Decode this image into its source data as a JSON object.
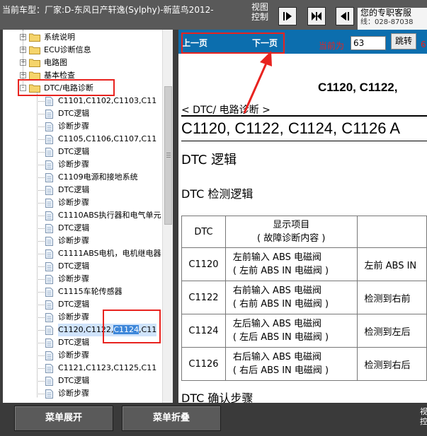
{
  "header": {
    "vehicle_label": "当前车型：厂家:D-东风日产轩逸(Sylphy)-新蓝鸟2012-",
    "view_control": "视图控制",
    "support_line1": "您的专职客服",
    "support_line2": "线：028-87038",
    "nav_buttons": [
      "go-next",
      "split-view",
      "go-previous"
    ]
  },
  "tree": {
    "items": [
      {
        "type": "folder",
        "label": "系统说明",
        "expander": "+"
      },
      {
        "type": "folder",
        "label": "ECU诊断信息",
        "expander": "+"
      },
      {
        "type": "folder",
        "label": "电路图",
        "expander": "+"
      },
      {
        "type": "folder",
        "label": "基本检查",
        "expander": "+"
      },
      {
        "type": "folder",
        "label": "DTC/电路诊断",
        "expander": "-",
        "open": true
      },
      {
        "type": "doc",
        "label": "C1101,C1102,C1103,C11"
      },
      {
        "type": "doc",
        "label": "DTC逻辑"
      },
      {
        "type": "doc",
        "label": "诊断步骤"
      },
      {
        "type": "doc",
        "label": "C1105,C1106,C1107,C11"
      },
      {
        "type": "doc",
        "label": "DTC逻辑"
      },
      {
        "type": "doc",
        "label": "诊断步骤"
      },
      {
        "type": "doc",
        "label": "C1109电源和接地系统"
      },
      {
        "type": "doc",
        "label": "DTC逻辑"
      },
      {
        "type": "doc",
        "label": "诊断步骤"
      },
      {
        "type": "doc",
        "label": "C1110ABS执行器和电气单元"
      },
      {
        "type": "doc",
        "label": "DTC逻辑"
      },
      {
        "type": "doc",
        "label": "诊断步骤"
      },
      {
        "type": "doc",
        "label": "C1111ABS电机，电机继电器"
      },
      {
        "type": "doc",
        "label": "DTC逻辑"
      },
      {
        "type": "doc",
        "label": "诊断步骤"
      },
      {
        "type": "doc",
        "label": "C1115车轮传感器"
      },
      {
        "type": "doc",
        "label": "DTC逻辑"
      },
      {
        "type": "doc",
        "label": "诊断步骤"
      },
      {
        "type": "doc",
        "label": "C1120,C1122,C1124,C11",
        "selected": true,
        "label_pre": "C1120,C1122,",
        "label_sel": "C1124",
        "label_post": ",C11"
      },
      {
        "type": "doc",
        "label": "DTC逻辑"
      },
      {
        "type": "doc",
        "label": "诊断步骤"
      },
      {
        "type": "doc",
        "label": "C1121,C1123,C1125,C11"
      },
      {
        "type": "doc",
        "label": "DTC逻辑"
      },
      {
        "type": "doc",
        "label": "诊断步骤"
      }
    ]
  },
  "content_nav": {
    "prev_label": "上一页",
    "next_label": "下一页",
    "page_label": "当前为",
    "page_value": "63",
    "jump_label": "跳转",
    "page_total_prefix": "6"
  },
  "document": {
    "title_right": "C1120, C1122,",
    "breadcrumb": "< DTC/ 电路诊断 >",
    "heading_codes": "C1120, C1122, C1124, C1126 A",
    "heading_logic": "DTC 逻辑",
    "heading_detect": "DTC 检测逻辑",
    "table": {
      "headers": {
        "dtc": "DTC",
        "display_line1": "显示项目",
        "display_line2": "( 故障诊断内容 )",
        "third": ""
      },
      "rows": [
        {
          "dtc": "C1120",
          "line1": "左前输入 ABS 电磁阀",
          "line2": "( 左前 ABS IN 电磁阀 )",
          "third": "左前 ABS IN"
        },
        {
          "dtc": "C1122",
          "line1": "右前输入 ABS 电磁阀",
          "line2": "( 右前 ABS IN 电磁阀 )",
          "third": "检测到右前"
        },
        {
          "dtc": "C1124",
          "line1": "左后输入 ABS 电磁阀",
          "line2": "( 左后 ABS IN 电磁阀 )",
          "third": "检测到左后"
        },
        {
          "dtc": "C1126",
          "line1": "右后输入 ABS 电磁阀",
          "line2": "( 右后 ABS IN 电磁阀 )",
          "third": "检测到右后"
        }
      ]
    },
    "heading_confirm": "DTC 确认步骤"
  },
  "bottom": {
    "expand_label": "菜单展开",
    "collapse_label": "菜单折叠",
    "view_control": "视控"
  },
  "colors": {
    "nav_strip": "#0c6eae",
    "annotation_red": "#e8231f",
    "selection": "#3c86d9"
  }
}
